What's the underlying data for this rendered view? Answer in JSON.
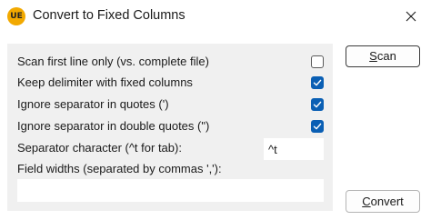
{
  "window": {
    "title": "Convert to Fixed Columns",
    "app_icon_text": "UE"
  },
  "options": [
    {
      "label": "Scan first line only (vs. complete file)",
      "checked": false
    },
    {
      "label": "Keep delimiter with fixed columns",
      "checked": true
    },
    {
      "label": "Ignore separator in quotes (')",
      "checked": true
    },
    {
      "label": "Ignore separator in double quotes (\")",
      "checked": true
    }
  ],
  "separator": {
    "label": "Separator character (^t for tab):",
    "value": "^t"
  },
  "field_widths": {
    "label": "Field widths (separated by commas ','):",
    "value": ""
  },
  "buttons": {
    "scan_first": "S",
    "scan_rest": "can",
    "convert_first": "C",
    "convert_rest": "onvert"
  },
  "colors": {
    "checkbox_checked": "#0a5fb4",
    "panel_bg": "#f0f0f0"
  }
}
